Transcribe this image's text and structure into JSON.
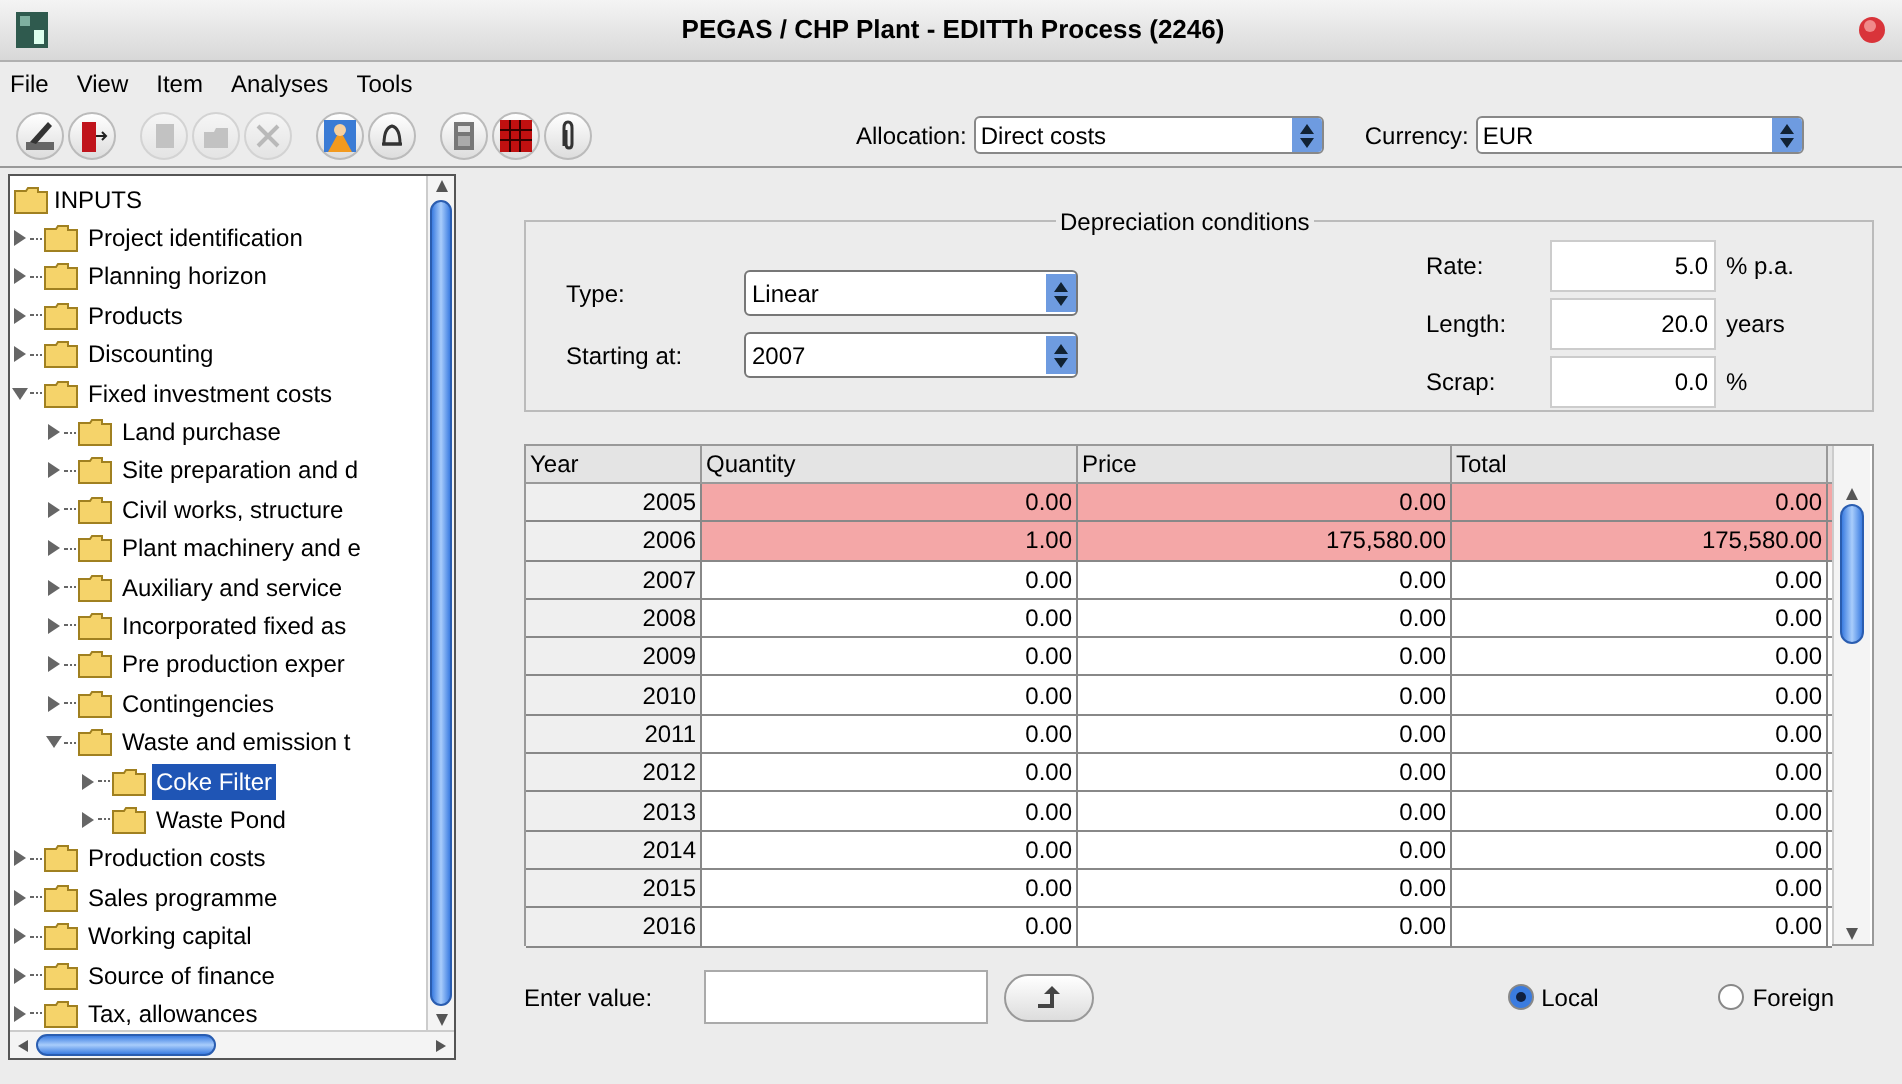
{
  "window": {
    "title": "PEGAS / CHP Plant - EDITTh Process (2246)"
  },
  "menu": [
    "File",
    "View",
    "Item",
    "Analyses",
    "Tools"
  ],
  "toolbar": [
    {
      "kind": "pen",
      "disabled": false
    },
    {
      "kind": "exit",
      "disabled": false
    },
    {
      "kind": "document",
      "disabled": true
    },
    {
      "kind": "folder",
      "disabled": true
    },
    {
      "kind": "close",
      "disabled": true
    },
    {
      "kind": "person",
      "disabled": false
    },
    {
      "kind": "bell",
      "disabled": false
    },
    {
      "kind": "calculator",
      "disabled": false
    },
    {
      "kind": "grid",
      "disabled": false
    },
    {
      "kind": "paperclip",
      "disabled": false
    }
  ],
  "allocation": {
    "label": "Allocation:",
    "value": "Direct costs"
  },
  "currency": {
    "label": "Currency:",
    "value": "EUR"
  },
  "tree": {
    "label": "INPUTS",
    "children": [
      {
        "label": "Project identification",
        "expanded": false,
        "selected": false
      },
      {
        "label": "Planning horizon",
        "expanded": false,
        "selected": false
      },
      {
        "label": "Products",
        "expanded": false,
        "selected": false
      },
      {
        "label": "Discounting",
        "expanded": false,
        "selected": false
      },
      {
        "label": "Fixed investment costs",
        "expanded": true,
        "selected": false,
        "children": [
          {
            "label": "Land purchase",
            "expanded": false,
            "selected": false
          },
          {
            "label": "Site preparation and d",
            "expanded": false,
            "selected": false
          },
          {
            "label": "Civil works, structure",
            "expanded": false,
            "selected": false
          },
          {
            "label": "Plant machinery and e",
            "expanded": false,
            "selected": false
          },
          {
            "label": "Auxiliary and service",
            "expanded": false,
            "selected": false
          },
          {
            "label": "Incorporated fixed as",
            "expanded": false,
            "selected": false
          },
          {
            "label": "Pre production exper",
            "expanded": false,
            "selected": false
          },
          {
            "label": "Contingencies",
            "expanded": false,
            "selected": false
          },
          {
            "label": "Waste and emission t",
            "expanded": true,
            "selected": false,
            "children": [
              {
                "label": "Coke Filter",
                "expanded": false,
                "selected": true
              },
              {
                "label": "Waste Pond",
                "expanded": false,
                "selected": false
              }
            ]
          }
        ]
      },
      {
        "label": "Production costs",
        "expanded": false,
        "selected": false
      },
      {
        "label": "Sales programme",
        "expanded": false,
        "selected": false
      },
      {
        "label": "Working capital",
        "expanded": false,
        "selected": false
      },
      {
        "label": "Source of finance",
        "expanded": false,
        "selected": false
      },
      {
        "label": "Tax, allowances",
        "expanded": false,
        "selected": false
      }
    ]
  },
  "depreciation": {
    "title": "Depreciation conditions",
    "type": {
      "label": "Type:",
      "value": "Linear"
    },
    "starting": {
      "label": "Starting at:",
      "value": "2007"
    },
    "rate": {
      "label": "Rate:",
      "value": "5.0",
      "unit": "% p.a."
    },
    "length": {
      "label": "Length:",
      "value": "20.0",
      "unit": "years"
    },
    "scrap": {
      "label": "Scrap:",
      "value": "0.0",
      "unit": "%"
    }
  },
  "table": {
    "columns": [
      "Year",
      "Quantity",
      "Price",
      "Total"
    ],
    "rows": [
      {
        "cells": [
          "2005",
          "0.00",
          "0.00",
          "0.00"
        ],
        "highlighted": true
      },
      {
        "cells": [
          "2006",
          "1.00",
          "175,580.00",
          "175,580.00"
        ],
        "highlighted": true
      },
      {
        "cells": [
          "2007",
          "0.00",
          "0.00",
          "0.00"
        ],
        "highlighted": false
      },
      {
        "cells": [
          "2008",
          "0.00",
          "0.00",
          "0.00"
        ],
        "highlighted": false
      },
      {
        "cells": [
          "2009",
          "0.00",
          "0.00",
          "0.00"
        ],
        "highlighted": false
      },
      {
        "cells": [
          "2010",
          "0.00",
          "0.00",
          "0.00"
        ],
        "highlighted": false
      },
      {
        "cells": [
          "2011",
          "0.00",
          "0.00",
          "0.00"
        ],
        "highlighted": false
      },
      {
        "cells": [
          "2012",
          "0.00",
          "0.00",
          "0.00"
        ],
        "highlighted": false
      },
      {
        "cells": [
          "2013",
          "0.00",
          "0.00",
          "0.00"
        ],
        "highlighted": false
      },
      {
        "cells": [
          "2014",
          "0.00",
          "0.00",
          "0.00"
        ],
        "highlighted": false
      },
      {
        "cells": [
          "2015",
          "0.00",
          "0.00",
          "0.00"
        ],
        "highlighted": false
      },
      {
        "cells": [
          "2016",
          "0.00",
          "0.00",
          "0.00"
        ],
        "highlighted": false
      }
    ]
  },
  "enter_value": {
    "label": "Enter value:"
  },
  "currency_mode": [
    {
      "label": "Local",
      "selected": true
    },
    {
      "label": "Foreign",
      "selected": false
    }
  ]
}
